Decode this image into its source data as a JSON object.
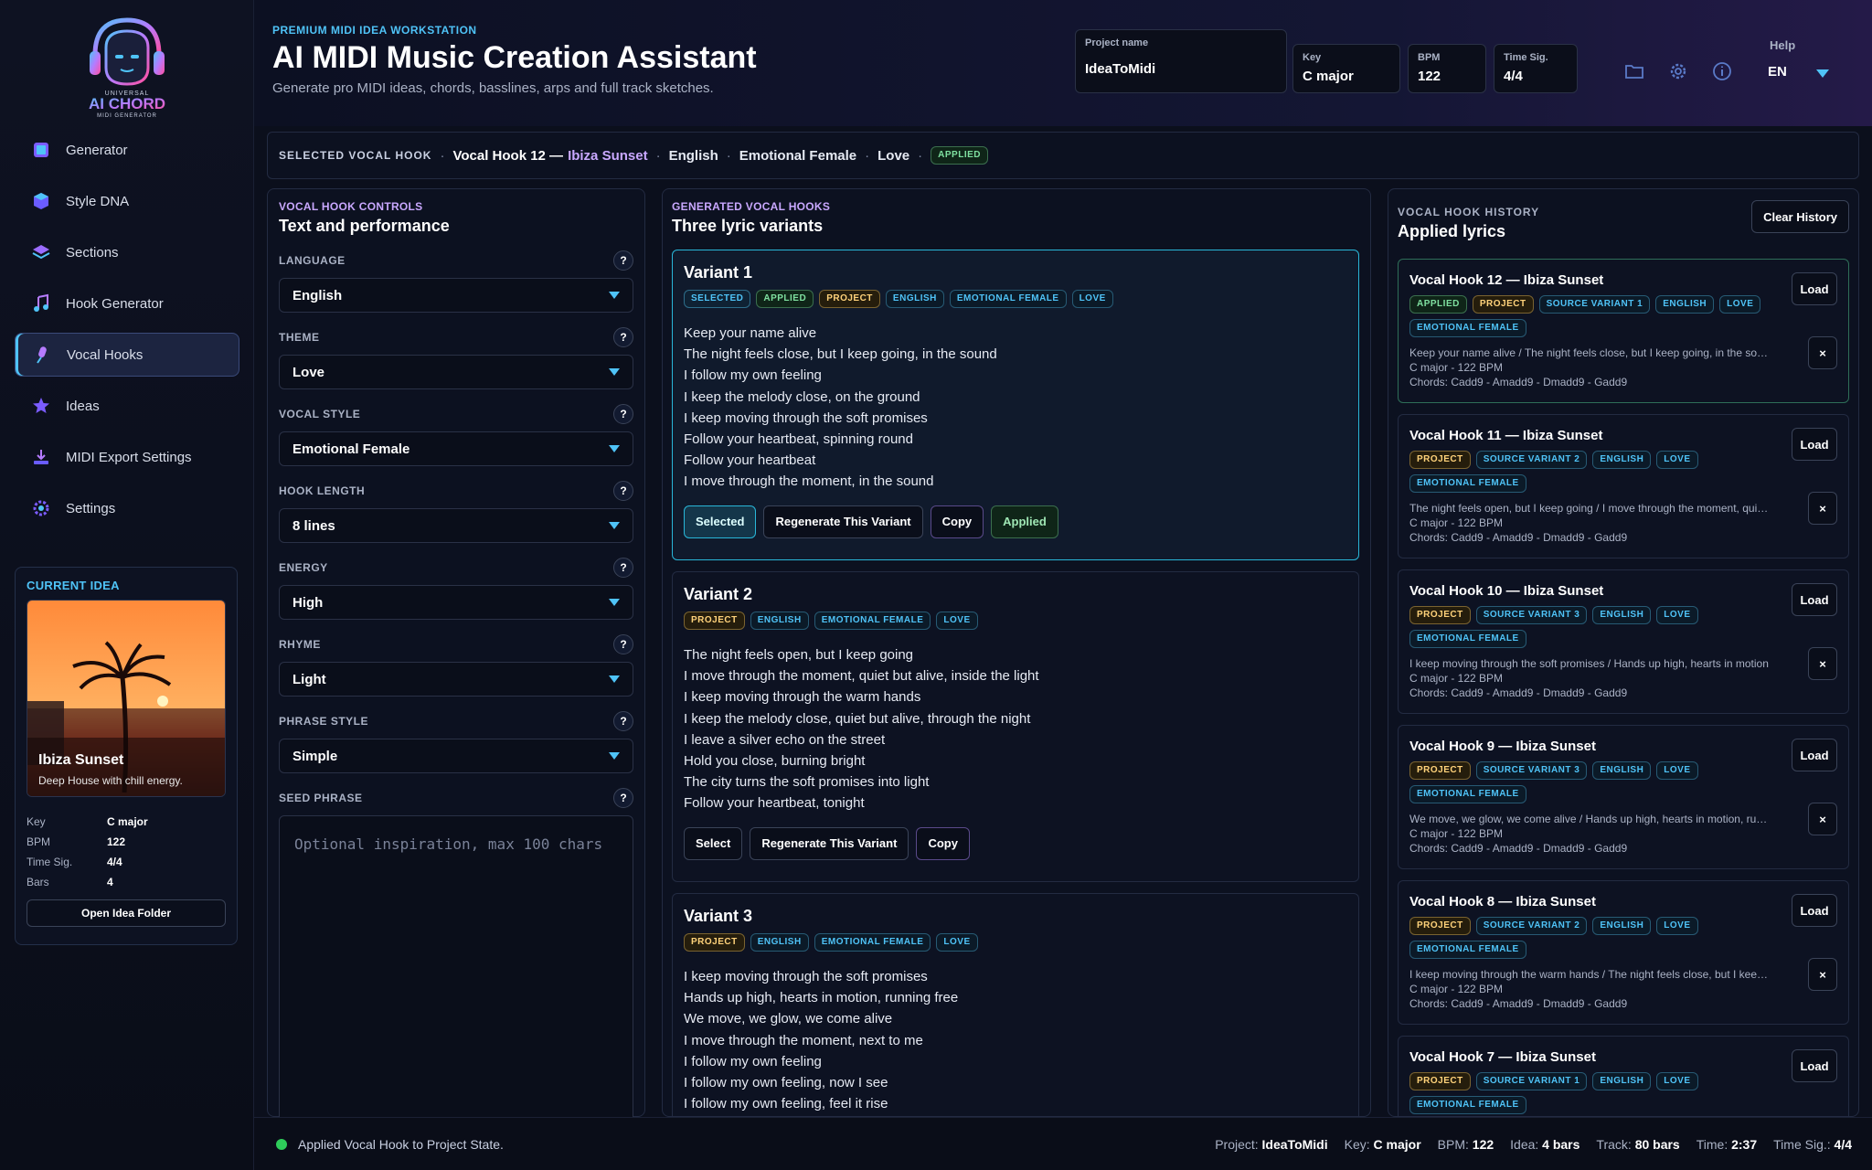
{
  "logo": {
    "line1": "UNIVERSAL",
    "line2": "AI CHORD",
    "line3": "MIDI GENERATOR"
  },
  "nav": [
    {
      "label": "Generator",
      "icon": "generator-icon"
    },
    {
      "label": "Style DNA",
      "icon": "cube-icon"
    },
    {
      "label": "Sections",
      "icon": "layers-icon"
    },
    {
      "label": "Hook Generator",
      "icon": "music-note-icon"
    },
    {
      "label": "Vocal Hooks",
      "icon": "microphone-icon",
      "active": true
    },
    {
      "label": "Ideas",
      "icon": "star-icon"
    },
    {
      "label": "MIDI Export Settings",
      "icon": "download-icon"
    },
    {
      "label": "Settings",
      "icon": "gear-icon"
    }
  ],
  "current_idea": {
    "title": "CURRENT IDEA",
    "name": "Ibiza Sunset",
    "desc": "Deep House with chill energy.",
    "props": [
      {
        "k": "Key",
        "v": "C major"
      },
      {
        "k": "BPM",
        "v": "122"
      },
      {
        "k": "Time Sig.",
        "v": "4/4"
      },
      {
        "k": "Bars",
        "v": "4"
      }
    ],
    "button": "Open Idea Folder"
  },
  "header": {
    "kicker": "PREMIUM MIDI IDEA WORKSTATION",
    "title": "AI MIDI Music Creation Assistant",
    "subtitle": "Generate pro MIDI ideas, chords, basslines, arps and full track sketches.",
    "project_label": "Project name",
    "project_value": "IdeaToMidi",
    "key_label": "Key",
    "key_value": "C major",
    "bpm_label": "BPM",
    "bpm_value": "122",
    "ts_label": "Time Sig.",
    "ts_value": "4/4",
    "help_label": "Help",
    "lang": "EN"
  },
  "selected": {
    "label": "SELECTED VOCAL HOOK",
    "hook_prefix": "Vocal Hook 12 —",
    "hook_name": "Ibiza Sunset",
    "language": "English",
    "style": "Emotional Female",
    "theme": "Love",
    "badge": "APPLIED"
  },
  "controls": {
    "kicker": "VOCAL HOOK CONTROLS",
    "title": "Text and performance",
    "items": [
      {
        "label": "LANGUAGE",
        "value": "English"
      },
      {
        "label": "THEME",
        "value": "Love"
      },
      {
        "label": "VOCAL STYLE",
        "value": "Emotional Female"
      },
      {
        "label": "HOOK LENGTH",
        "value": "8 lines"
      },
      {
        "label": "ENERGY",
        "value": "High"
      },
      {
        "label": "RHYME",
        "value": "Light"
      },
      {
        "label": "PHRASE STYLE",
        "value": "Simple"
      }
    ],
    "seed_label": "SEED PHRASE",
    "seed_placeholder": "Optional inspiration, max 100 chars",
    "help": "?"
  },
  "generated": {
    "kicker": "GENERATED VOCAL HOOKS",
    "title": "Three lyric variants",
    "variants": [
      {
        "title": "Variant 1",
        "tags": [
          "SELECTED",
          "APPLIED",
          "PROJECT",
          "ENGLISH",
          "EMOTIONAL FEMALE",
          "LOVE"
        ],
        "lines": [
          "Keep your name alive",
          "The night feels close, but I keep going, in the sound",
          "I follow my own feeling",
          "I keep the melody close, on the ground",
          "I keep moving through the soft promises",
          "Follow your heartbeat, spinning round",
          "Follow your heartbeat",
          "I move through the moment, in the sound"
        ],
        "buttons": [
          "Selected",
          "Regenerate This Variant",
          "Copy",
          "Applied"
        ]
      },
      {
        "title": "Variant 2",
        "tags": [
          "PROJECT",
          "ENGLISH",
          "EMOTIONAL FEMALE",
          "LOVE"
        ],
        "lines": [
          "The night feels open, but I keep going",
          "I move through the moment, quiet but alive, inside the light",
          "I keep moving through the warm hands",
          "I keep the melody close, quiet but alive, through the night",
          "I leave a silver echo on the street",
          "Hold you close, burning bright",
          "The city turns the soft promises into light",
          "Follow your heartbeat, tonight"
        ],
        "buttons": [
          "Select",
          "Regenerate This Variant",
          "Copy"
        ]
      },
      {
        "title": "Variant 3",
        "tags": [
          "PROJECT",
          "ENGLISH",
          "EMOTIONAL FEMALE",
          "LOVE"
        ],
        "lines": [
          "I keep moving through the soft promises",
          "Hands up high, hearts in motion, running free",
          "We move, we glow, we come alive",
          "I move through the moment, next to me",
          "I follow my own feeling",
          "I follow my own feeling, now I see",
          "I follow my own feeling, feel it rise"
        ],
        "buttons": []
      }
    ]
  },
  "history": {
    "kicker": "VOCAL HOOK HISTORY",
    "title": "Applied lyrics",
    "clear": "Clear History",
    "load": "Load",
    "del": "×",
    "items": [
      {
        "name": "Vocal Hook 12 — Ibiza Sunset",
        "tags": [
          "APPLIED",
          "PROJECT",
          "SOURCE VARIANT 1",
          "ENGLISH",
          "LOVE",
          "EMOTIONAL FEMALE"
        ],
        "lyric": "Keep your name alive / The night feels close, but I keep going, in the sound",
        "key": "C major - 122 BPM",
        "chords": "Chords: Cadd9 - Amadd9 - Dmadd9 - Gadd9",
        "applied": true
      },
      {
        "name": "Vocal Hook 11 — Ibiza Sunset",
        "tags": [
          "PROJECT",
          "SOURCE VARIANT 2",
          "ENGLISH",
          "LOVE",
          "EMOTIONAL FEMALE"
        ],
        "lyric": "The night feels open, but I keep going / I move through the moment, quiet but alive",
        "key": "C major - 122 BPM",
        "chords": "Chords: Cadd9 - Amadd9 - Dmadd9 - Gadd9"
      },
      {
        "name": "Vocal Hook 10 — Ibiza Sunset",
        "tags": [
          "PROJECT",
          "SOURCE VARIANT 3",
          "ENGLISH",
          "LOVE",
          "EMOTIONAL FEMALE"
        ],
        "lyric": "I keep moving through the soft promises / Hands up high, hearts in motion",
        "key": "C major - 122 BPM",
        "chords": "Chords: Cadd9 - Amadd9 - Dmadd9 - Gadd9"
      },
      {
        "name": "Vocal Hook 9 — Ibiza Sunset",
        "tags": [
          "PROJECT",
          "SOURCE VARIANT 3",
          "ENGLISH",
          "LOVE",
          "EMOTIONAL FEMALE"
        ],
        "lyric": "We move, we glow, we come alive / Hands up high, hearts in motion, running free",
        "key": "C major - 122 BPM",
        "chords": "Chords: Cadd9 - Amadd9 - Dmadd9 - Gadd9"
      },
      {
        "name": "Vocal Hook 8 — Ibiza Sunset",
        "tags": [
          "PROJECT",
          "SOURCE VARIANT 2",
          "ENGLISH",
          "LOVE",
          "EMOTIONAL FEMALE"
        ],
        "lyric": "I keep moving through the warm hands / The night feels close, but I keep going",
        "key": "C major - 122 BPM",
        "chords": "Chords: Cadd9 - Amadd9 - Dmadd9 - Gadd9"
      },
      {
        "name": "Vocal Hook 7 — Ibiza Sunset",
        "tags": [
          "PROJECT",
          "SOURCE VARIANT 1",
          "ENGLISH",
          "LOVE",
          "EMOTIONAL FEMALE"
        ],
        "lyric": "",
        "key": "",
        "chords": ""
      }
    ]
  },
  "status": {
    "message": "Applied Vocal Hook to Project State.",
    "project_k": "Project:",
    "project_v": "IdeaToMidi",
    "key_k": "Key:",
    "key_v": "C major",
    "bpm_k": "BPM:",
    "bpm_v": "122",
    "idea_k": "Idea:",
    "idea_v": "4 bars",
    "track_k": "Track:",
    "track_v": "80 bars",
    "time_k": "Time:",
    "time_v": "2:37",
    "ts_k": "Time Sig.:",
    "ts_v": "4/4"
  }
}
